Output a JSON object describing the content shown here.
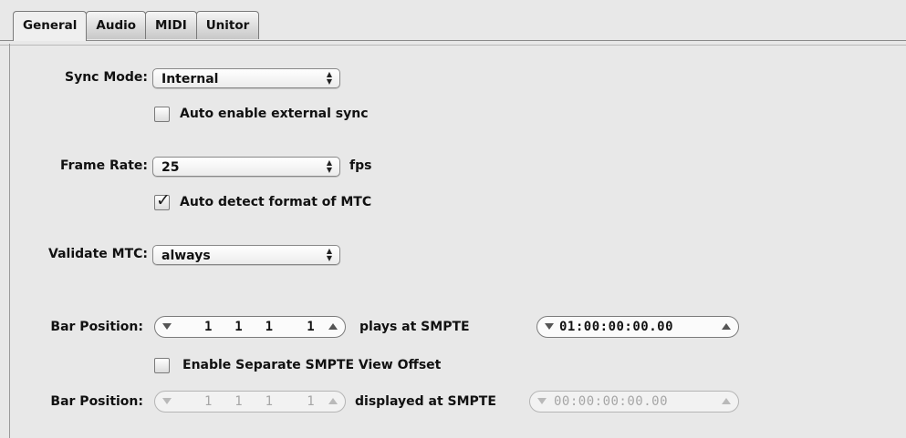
{
  "tabs": [
    {
      "label": "General",
      "active": true
    },
    {
      "label": "Audio",
      "active": false
    },
    {
      "label": "MIDI",
      "active": false
    },
    {
      "label": "Unitor",
      "active": false
    }
  ],
  "sync_mode": {
    "label": "Sync Mode:",
    "value": "Internal"
  },
  "auto_enable": {
    "label": "Auto enable external sync",
    "checked": false
  },
  "frame_rate": {
    "label": "Frame Rate:",
    "value": "25",
    "unit": "fps"
  },
  "auto_detect": {
    "label": "Auto detect format of MTC",
    "checked": true
  },
  "validate": {
    "label": "Validate MTC:",
    "value": "always"
  },
  "bar1": {
    "label": "Bar Position:",
    "position": "1  1  1   1",
    "plays_label": "plays at SMPTE",
    "smpte": "01:00:00:00.00"
  },
  "separate_offset": {
    "label": "Enable Separate SMPTE View Offset",
    "checked": false
  },
  "bar2": {
    "label": "Bar Position:",
    "position": "1  1  1   1",
    "displayed_label": "displayed at SMPTE",
    "smpte": "00:00:00:00.00"
  }
}
